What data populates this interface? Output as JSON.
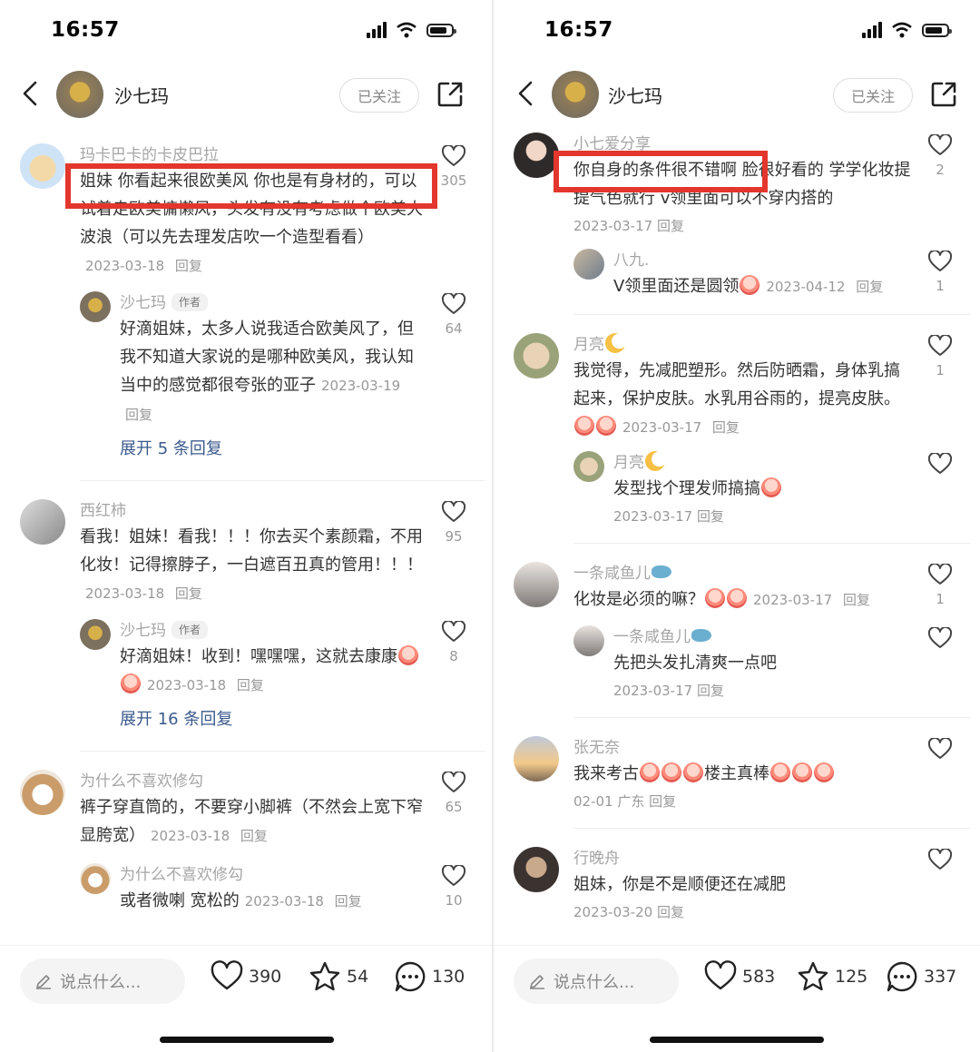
{
  "screens": [
    {
      "status_time": "16:57",
      "user_name": "沙七玛",
      "follow_label": "已关注",
      "comments": [
        {
          "user": "玛卡巴卡的卡皮巴拉",
          "text": "姐妹 你看起来很欧美风 你也是有身材的，可以试着走欧美慵懒风，头发有没有考虑做个欧美大波浪（可以先去理发店吹一个造型看看）",
          "date": "2023-03-18",
          "reply_label": "回复",
          "likes": "305",
          "replies": [
            {
              "user": "沙七玛",
              "tag": "作者",
              "text": "好滴姐妹，太多人说我适合欧美风了，但我不知道大家说的是哪种欧美风，我认知当中的感觉都很夸张的亚子",
              "date": "2023-03-19",
              "reply_label": "回复",
              "likes": "64"
            }
          ],
          "expand": "展开 5 条回复"
        },
        {
          "user": "西红柿",
          "text": "看我！姐妹！看我！！！你去买个素颜霜，不用化妆！记得擦脖子，一白遮百丑真的管用！！！",
          "date": "2023-03-18",
          "reply_label": "回复",
          "likes": "95",
          "replies": [
            {
              "user": "沙七玛",
              "tag": "作者",
              "text": "好滴姐妹！收到！嘿嘿嘿，这就去康康",
              "date": "2023-03-18",
              "reply_label": "回复",
              "likes": "8"
            }
          ],
          "expand": "展开 16 条回复"
        },
        {
          "user": "为什么不喜欢修勾",
          "text": "裤子穿直筒的，不要穿小脚裤（不然会上宽下窄显胯宽）",
          "date": "2023-03-18",
          "reply_label": "回复",
          "likes": "65",
          "replies": [
            {
              "user": "为什么不喜欢修勾",
              "tag": "",
              "text": "或者微喇 宽松的",
              "date": "2023-03-18",
              "reply_label": "回复",
              "likes": "10"
            }
          ],
          "expand": ""
        }
      ],
      "bottom": {
        "say_placeholder": "说点什么...",
        "likes": "390",
        "stars": "54",
        "comments": "130"
      }
    },
    {
      "status_time": "16:57",
      "user_name": "沙七玛",
      "follow_label": "已关注",
      "comments": [
        {
          "user": "小七爱分享",
          "text": "你自身的条件很不错啊 脸很好看的 学学化妆提提气色就行 v领里面可以不穿内搭的",
          "date": "2023-03-17",
          "reply_label": "回复",
          "likes": "2",
          "replies": [
            {
              "user": "八九.",
              "tag": "",
              "text": "V领里面还是圆领",
              "date": "2023-04-12",
              "reply_label": "回复",
              "likes": "1"
            }
          ]
        },
        {
          "user": "月亮",
          "text": "我觉得，先减肥塑形。然后防晒霜，身体乳搞起来，保护皮肤。水乳用谷雨的，提亮皮肤。",
          "date": "2023-03-17",
          "reply_label": "回复",
          "likes": "1",
          "replies": [
            {
              "user": "月亮",
              "tag": "",
              "text": "发型找个理发师搞搞",
              "date": "2023-03-17",
              "reply_label": "回复",
              "likes": ""
            }
          ]
        },
        {
          "user": "一条咸鱼儿",
          "text": "化妆是必须的嘛？",
          "date": "2023-03-17",
          "reply_label": "回复",
          "likes": "1",
          "replies": [
            {
              "user": "一条咸鱼儿",
              "tag": "",
              "text": "先把头发扎清爽一点吧",
              "date": "2023-03-17",
              "reply_label": "回复",
              "likes": ""
            }
          ]
        },
        {
          "user": "张无奈",
          "text": "我来考古",
          "text2": "楼主真棒",
          "date": "02-01 广东",
          "reply_label": "回复",
          "likes": "",
          "replies": []
        },
        {
          "user": "行晚舟",
          "text": "姐妹，你是不是顺便还在减肥",
          "date": "2023-03-20",
          "reply_label": "回复",
          "likes": "",
          "replies": []
        }
      ],
      "bottom": {
        "say_placeholder": "说点什么...",
        "likes": "583",
        "stars": "125",
        "comments": "337"
      }
    }
  ],
  "highlight_color": "#e3362d",
  "icons": [
    "back-arrow-icon",
    "share-icon",
    "heart-icon",
    "star-icon",
    "comment-bubble-icon",
    "pencil-icon",
    "wifi-icon",
    "signal-icon",
    "battery-icon"
  ]
}
